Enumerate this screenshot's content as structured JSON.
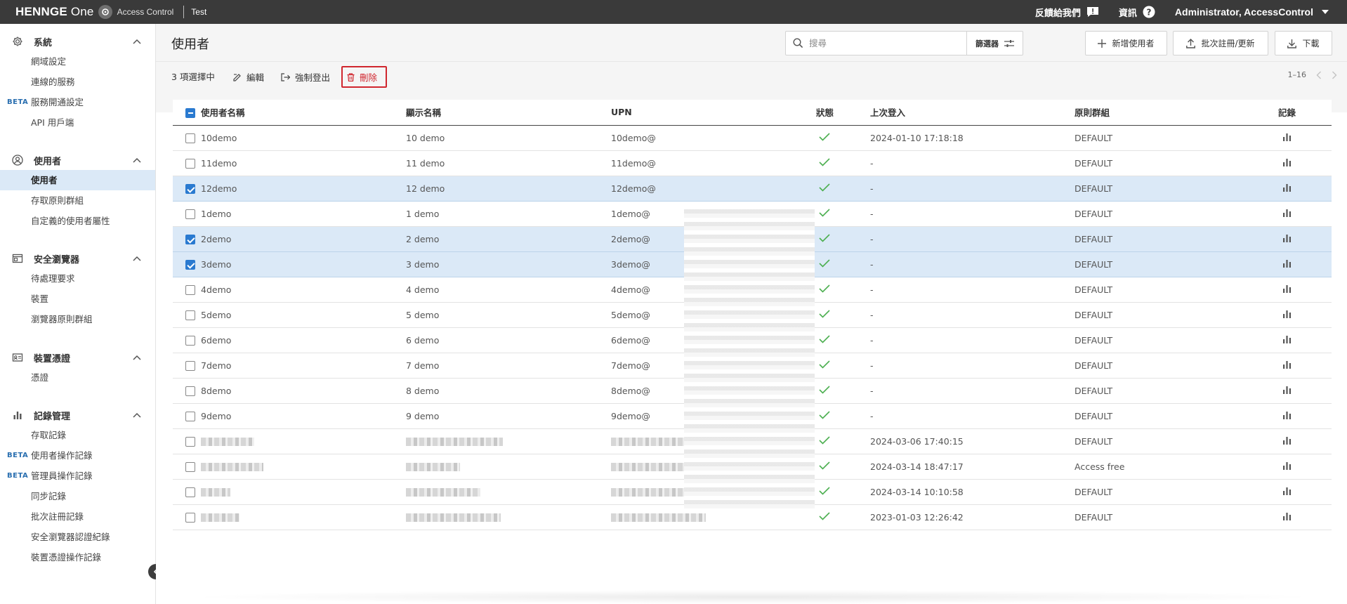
{
  "topbar": {
    "logo_main": "HENNGE ",
    "logo_thin": "One",
    "product": "Access Control",
    "tenant": "Test",
    "feedback": "反饋給我們",
    "info": "資訊",
    "admin": "Administrator, AccessControl"
  },
  "sidebar": {
    "groups": [
      {
        "title": "系統",
        "icon": "gear-icon",
        "items": [
          {
            "label": "網域設定",
            "beta": ""
          },
          {
            "label": "連線的服務",
            "beta": ""
          },
          {
            "label": "服務開通設定",
            "beta": "BETA"
          },
          {
            "label": "API 用戶端",
            "beta": ""
          }
        ]
      },
      {
        "title": "使用者",
        "icon": "user-circle-icon",
        "items": [
          {
            "label": "使用者",
            "beta": "",
            "active": true
          },
          {
            "label": "存取原則群組",
            "beta": ""
          },
          {
            "label": "自定義的使用者屬性",
            "beta": ""
          }
        ]
      },
      {
        "title": "安全瀏覽器",
        "icon": "browser-icon",
        "items": [
          {
            "label": "待處理要求",
            "beta": ""
          },
          {
            "label": "裝置",
            "beta": ""
          },
          {
            "label": "瀏覽器原則群組",
            "beta": ""
          }
        ]
      },
      {
        "title": "裝置憑證",
        "icon": "certificate-icon",
        "items": [
          {
            "label": "憑證",
            "beta": ""
          }
        ]
      },
      {
        "title": "記錄管理",
        "icon": "bar-chart-icon",
        "items": [
          {
            "label": "存取記錄",
            "beta": ""
          },
          {
            "label": "使用者操作記錄",
            "beta": "BETA"
          },
          {
            "label": "管理員操作記錄",
            "beta": "BETA"
          },
          {
            "label": "同步記錄",
            "beta": ""
          },
          {
            "label": "批次註冊記錄",
            "beta": ""
          },
          {
            "label": "安全瀏覽器認證紀錄",
            "beta": ""
          },
          {
            "label": "裝置憑證操作記錄",
            "beta": ""
          }
        ]
      }
    ]
  },
  "header": {
    "title": "使用者",
    "search_placeholder": "搜尋",
    "filter_label": "篩選器",
    "add_user": "新增使用者",
    "bulk": "批次註冊/更新",
    "download": "下載"
  },
  "toolbar": {
    "selected": "3 項選擇中",
    "edit": "編輯",
    "force_logout": "強制登出",
    "delete": "刪除",
    "range": "1–16"
  },
  "table": {
    "columns": [
      "使用者名稱",
      "顯示名稱",
      "UPN",
      "狀態",
      "上次登入",
      "原則群組",
      "記錄"
    ],
    "rows": [
      {
        "username": "10demo",
        "display": "10 demo",
        "upn": "10demo@",
        "last": "2024-01-10 17:18:18",
        "policy": "DEFAULT",
        "selected": false
      },
      {
        "username": "11demo",
        "display": "11 demo",
        "upn": "11demo@",
        "last": "-",
        "policy": "DEFAULT",
        "selected": false
      },
      {
        "username": "12demo",
        "display": "12 demo",
        "upn": "12demo@",
        "last": "-",
        "policy": "DEFAULT",
        "selected": true
      },
      {
        "username": "1demo",
        "display": "1 demo",
        "upn": "1demo@",
        "last": "-",
        "policy": "DEFAULT",
        "selected": false
      },
      {
        "username": "2demo",
        "display": "2 demo",
        "upn": "2demo@",
        "last": "-",
        "policy": "DEFAULT",
        "selected": true
      },
      {
        "username": "3demo",
        "display": "3 demo",
        "upn": "3demo@",
        "last": "-",
        "policy": "DEFAULT",
        "selected": true
      },
      {
        "username": "4demo",
        "display": "4 demo",
        "upn": "4demo@",
        "last": "-",
        "policy": "DEFAULT",
        "selected": false
      },
      {
        "username": "5demo",
        "display": "5 demo",
        "upn": "5demo@",
        "last": "-",
        "policy": "DEFAULT",
        "selected": false
      },
      {
        "username": "6demo",
        "display": "6 demo",
        "upn": "6demo@",
        "last": "-",
        "policy": "DEFAULT",
        "selected": false
      },
      {
        "username": "7demo",
        "display": "7 demo",
        "upn": "7demo@",
        "last": "-",
        "policy": "DEFAULT",
        "selected": false
      },
      {
        "username": "8demo",
        "display": "8 demo",
        "upn": "8demo@",
        "last": "-",
        "policy": "DEFAULT",
        "selected": false
      },
      {
        "username": "9demo",
        "display": "9 demo",
        "upn": "9demo@",
        "last": "-",
        "policy": "DEFAULT",
        "selected": false
      },
      {
        "username": "",
        "display": "",
        "upn": "",
        "last": "2024-03-06 17:40:15",
        "policy": "DEFAULT",
        "selected": false
      },
      {
        "username": "",
        "display": "",
        "upn": "",
        "last": "2024-03-14 18:47:17",
        "policy": "Access free",
        "selected": false
      },
      {
        "username": "",
        "display": "",
        "upn": "",
        "last": "2024-03-14 10:10:58",
        "policy": "DEFAULT",
        "selected": false
      },
      {
        "username": "",
        "display": "",
        "upn": "",
        "last": "2023-01-03 12:26:42",
        "policy": "DEFAULT",
        "selected": false
      }
    ]
  },
  "colors": {
    "accent": "#2a7ad0",
    "selected_row": "#dbe9f7",
    "danger": "#d0262e",
    "status_ok": "#4caf50",
    "topbar": "#3a3a3a"
  }
}
